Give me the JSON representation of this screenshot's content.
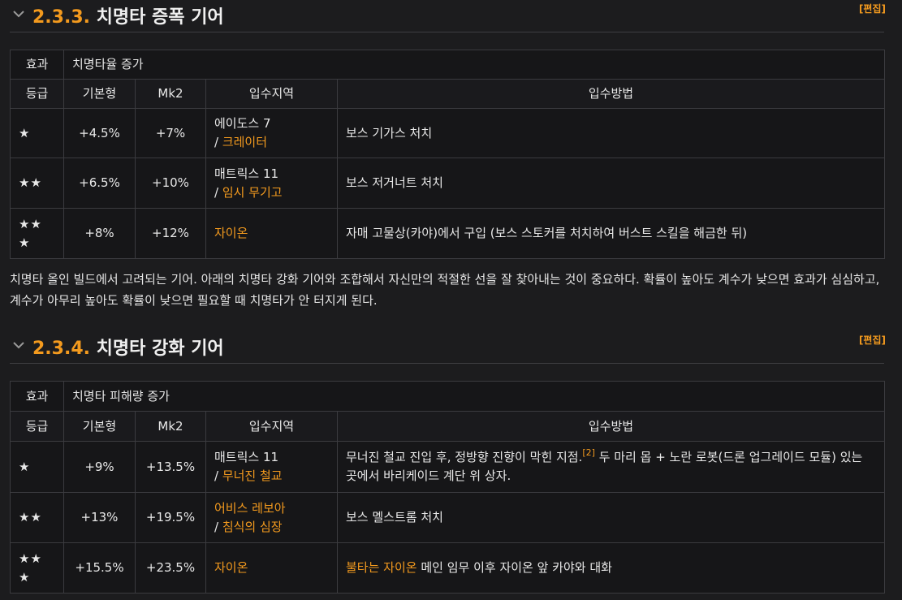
{
  "sections": [
    {
      "number": "2.3.3.",
      "title": "치명타 증폭 기어",
      "edit": "[편집]",
      "effect_label": "효과",
      "effect_value": "치명타율 증가",
      "columns": [
        "등급",
        "기본형",
        "Mk2",
        "입수지역",
        "입수방법"
      ],
      "rows": [
        {
          "grade": "★",
          "base": "+4.5%",
          "mk2": "+7%",
          "region": "에이도스 7",
          "sub_prefix": "/ ",
          "subregion": "크레이터",
          "method": "보스 기가스 처치"
        },
        {
          "grade": "★★",
          "base": "+6.5%",
          "mk2": "+10%",
          "region": "매트릭스 11",
          "sub_prefix": "/ ",
          "subregion": "임시 무기고",
          "method": "보스 저거너트 처치"
        },
        {
          "grade": "★★",
          "grade2": "★",
          "base": "+8%",
          "mk2": "+12%",
          "region_link": "자이온",
          "method": "자매 고물상(카야)에서 구입 (보스 스토커를 처치하여 버스트 스킬을 해금한 뒤)"
        }
      ],
      "description": "치명타 올인 빌드에서 고려되는 기어. 아래의 치명타 강화 기어와 조합해서 자신만의 적절한 선을 잘 찾아내는 것이 중요하다. 확률이 높아도 계수가 낮으면 효과가 심심하고, 계수가 아무리 높아도 확률이 낮으면 필요할 때 치명타가 안 터지게 된다."
    },
    {
      "number": "2.3.4.",
      "title": "치명타 강화 기어",
      "edit": "[편집]",
      "effect_label": "효과",
      "effect_value": "치명타 피해량 증가",
      "columns": [
        "등급",
        "기본형",
        "Mk2",
        "입수지역",
        "입수방법"
      ],
      "rows": [
        {
          "grade": "★",
          "base": "+9%",
          "mk2": "+13.5%",
          "region": "매트릭스 11",
          "sub_prefix": "/ ",
          "subregion": "무너진 철교",
          "method_a": "무너진 철교 진입 후, 정방향 진향이 막힌 지점.",
          "footnote": "[2]",
          "method_b": " 두 마리 몹 + 노란 로봇(드론 업그레이드 모듈) 있는 곳에서 바리케이드 계단 위 상자."
        },
        {
          "grade": "★★",
          "base": "+13%",
          "mk2": "+19.5%",
          "region_link": "어비스 레보아",
          "sub_prefix": "/ ",
          "subregion": "침식의 심장",
          "method": "보스 멜스트롬 처치"
        },
        {
          "grade": "★★",
          "grade2": "★",
          "base": "+15.5%",
          "mk2": "+23.5%",
          "region_link": "자이온",
          "method_link": "불타는 자이온",
          "method_rest": " 메인 임무 이후 자이온 앞 카야와 대화"
        }
      ]
    }
  ],
  "colors": {
    "accent": "#f39a1e",
    "background": "#1c1c1e",
    "table_bg": "#161618",
    "border": "#3b3b3f"
  },
  "icons": {
    "heading_toggle": "chevron-down-icon",
    "grade": "star-icon"
  }
}
